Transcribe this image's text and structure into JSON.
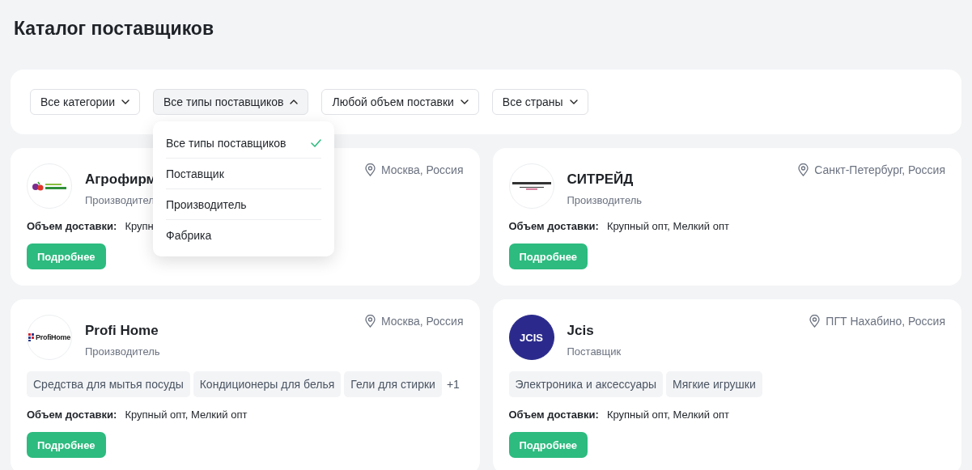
{
  "page_title": "Каталог поставщиков",
  "filters": [
    {
      "label": "Все категории",
      "expanded": false
    },
    {
      "label": "Все типы поставщиков",
      "expanded": true,
      "options": [
        {
          "label": "Все типы поставщиков",
          "selected": true
        },
        {
          "label": "Поставщик",
          "selected": false
        },
        {
          "label": "Производитель",
          "selected": false
        },
        {
          "label": "Фабрика",
          "selected": false
        }
      ]
    },
    {
      "label": "Любой объем поставки",
      "expanded": false
    },
    {
      "label": "Все страны",
      "expanded": false
    }
  ],
  "suppliers": [
    {
      "name": "Агрофирм",
      "type": "Производител",
      "location": "Москва, Россия",
      "logo": {
        "kind": "agro"
      },
      "delivery_label": "Объем доставки:",
      "delivery": "Крупн",
      "button": "Подробнее"
    },
    {
      "name": "СИТРЕЙД",
      "type": "Производитель",
      "location": "Санкт-Петербург, Россия",
      "logo": {
        "kind": "textile"
      },
      "delivery_label": "Объем доставки:",
      "delivery": "Крупный опт, Мелкий опт",
      "button": "Подробнее"
    },
    {
      "name": "Profi Home",
      "type": "Производитель",
      "location": "Москва, Россия",
      "logo": {
        "kind": "profi",
        "text": "ProfiHome"
      },
      "tags": [
        "Средства для мытья посуды",
        "Кондиционеры для белья",
        "Гели для стирки"
      ],
      "more": "+1",
      "delivery_label": "Объем доставки:",
      "delivery": "Крупный опт, Мелкий опт",
      "button": "Подробнее"
    },
    {
      "name": "Jcis",
      "type": "Поставщик",
      "location": "ПГТ Нахабино, Россия",
      "logo": {
        "kind": "jcis",
        "text": "JCIS"
      },
      "tags": [
        "Электроника и аксессуары",
        "Мягкие игрушки"
      ],
      "delivery_label": "Объем доставки:",
      "delivery": "Крупный опт, Мелкий опт",
      "button": "Подробнее"
    }
  ]
}
